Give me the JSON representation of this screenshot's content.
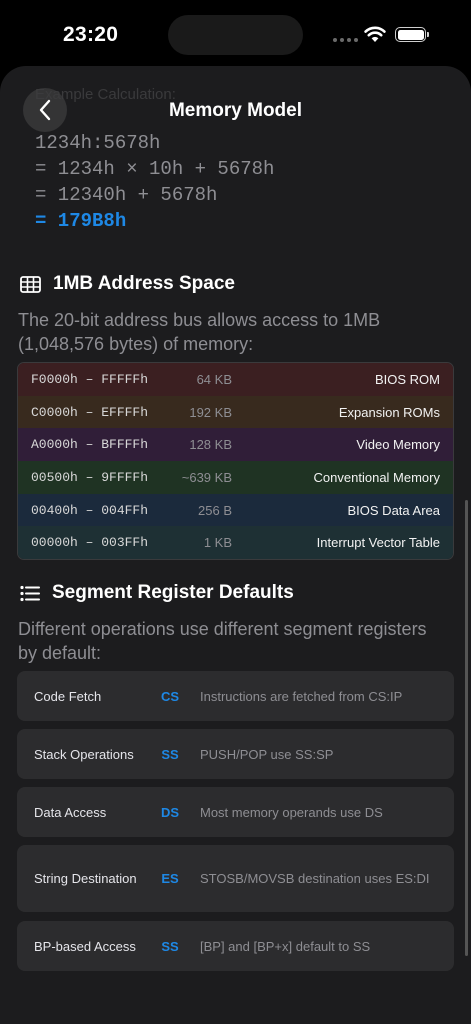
{
  "status": {
    "time": "23:20"
  },
  "nav": {
    "title": "Memory Model",
    "faded_label": "Example Calculation:"
  },
  "calculation": {
    "lines": [
      "1234h:5678h",
      "= 1234h × 10h + 5678h",
      "= 12340h + 5678h"
    ],
    "result": "= 179B8h"
  },
  "address_space": {
    "heading": "1MB Address Space",
    "description": "The 20-bit address bus allows access to 1MB (1,048,576 bytes) of memory:",
    "rows": [
      {
        "range": "F0000h – FFFFFh",
        "size": "64 KB",
        "name": "BIOS ROM",
        "color": "#3b1f21"
      },
      {
        "range": "C0000h – EFFFFh",
        "size": "192 KB",
        "name": "Expansion ROMs",
        "color": "#382a1e"
      },
      {
        "range": "A0000h – BFFFFh",
        "size": "128 KB",
        "name": "Video Memory",
        "color": "#301e38"
      },
      {
        "range": "00500h – 9FFFFh",
        "size": "~639 KB",
        "name": "Conventional Memory",
        "color": "#1f3323"
      },
      {
        "range": "00400h – 004FFh",
        "size": "256 B",
        "name": "BIOS Data Area",
        "color": "#1b2a3c"
      },
      {
        "range": "00000h – 003FFh",
        "size": "1 KB",
        "name": "Interrupt Vector Table",
        "color": "#1e3034"
      }
    ]
  },
  "segments": {
    "heading": "Segment Register Defaults",
    "description": "Different operations use different segment registers by default:",
    "cards": [
      {
        "op": "Code Fetch",
        "reg": "CS",
        "desc": "Instructions are fetched from CS:IP"
      },
      {
        "op": "Stack Operations",
        "reg": "SS",
        "desc": "PUSH/POP use SS:SP"
      },
      {
        "op": "Data Access",
        "reg": "DS",
        "desc": "Most memory operands use DS"
      },
      {
        "op": "String Destination",
        "reg": "ES",
        "desc": "STOSB/MOVSB destination uses ES:DI"
      },
      {
        "op": "BP-based Access",
        "reg": "SS",
        "desc": "[BP] and [BP+x] default to SS"
      }
    ]
  },
  "colors": {
    "accent": "#1e88e5",
    "sheet": "#1c1c1e",
    "card": "#2c2c2e"
  }
}
